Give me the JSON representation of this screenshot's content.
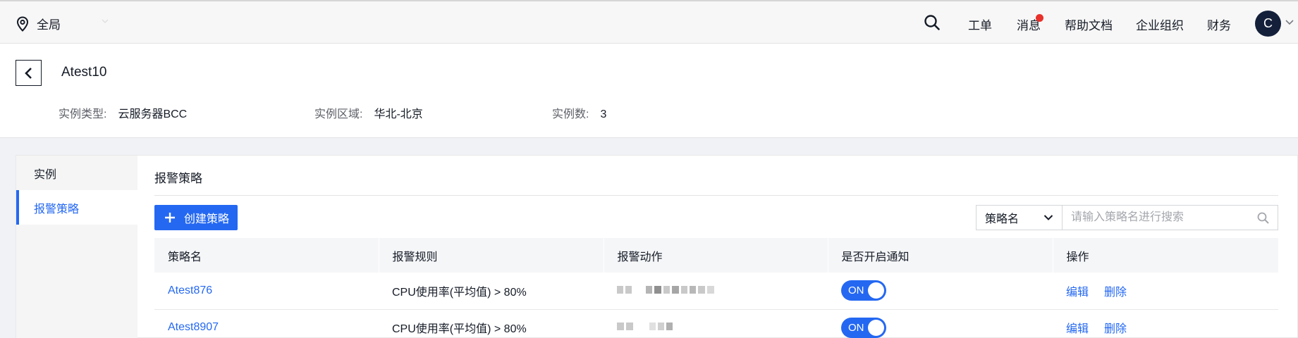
{
  "topbar": {
    "region_label": "全局",
    "nav": {
      "tickets": "工单",
      "messages": "消息",
      "help_docs": "帮助文档",
      "organization": "企业组织",
      "finance": "财务"
    },
    "avatar_letter": "C",
    "notification_color": "#e8312a"
  },
  "header": {
    "title": "Atest10",
    "instance_type_label": "实例类型:",
    "instance_type_value": "云服务器BCC",
    "instance_region_label": "实例区域:",
    "instance_region_value": "华北-北京",
    "instance_count_label": "实例数:",
    "instance_count_value": "3"
  },
  "sidenav": {
    "items": [
      {
        "label": "实例",
        "active": false
      },
      {
        "label": "报警策略",
        "active": true
      }
    ]
  },
  "panel": {
    "title": "报警策略",
    "create_button": "创建策略",
    "search": {
      "field_selected": "策略名",
      "placeholder": "请输入策略名进行搜索"
    },
    "table": {
      "headers": [
        "策略名",
        "报警规则",
        "报警动作",
        "是否开启通知",
        "操作"
      ],
      "rows": [
        {
          "name": "Atest876",
          "rule": "CPU使用率(平均值) > 80%",
          "notify": "ON",
          "edit": "编辑",
          "delete": "删除"
        },
        {
          "name": "Atest8907",
          "rule": "CPU使用率(平均值) > 80%",
          "notify": "ON",
          "edit": "编辑",
          "delete": "删除"
        }
      ]
    }
  },
  "colors": {
    "accent": "#2468f2"
  }
}
